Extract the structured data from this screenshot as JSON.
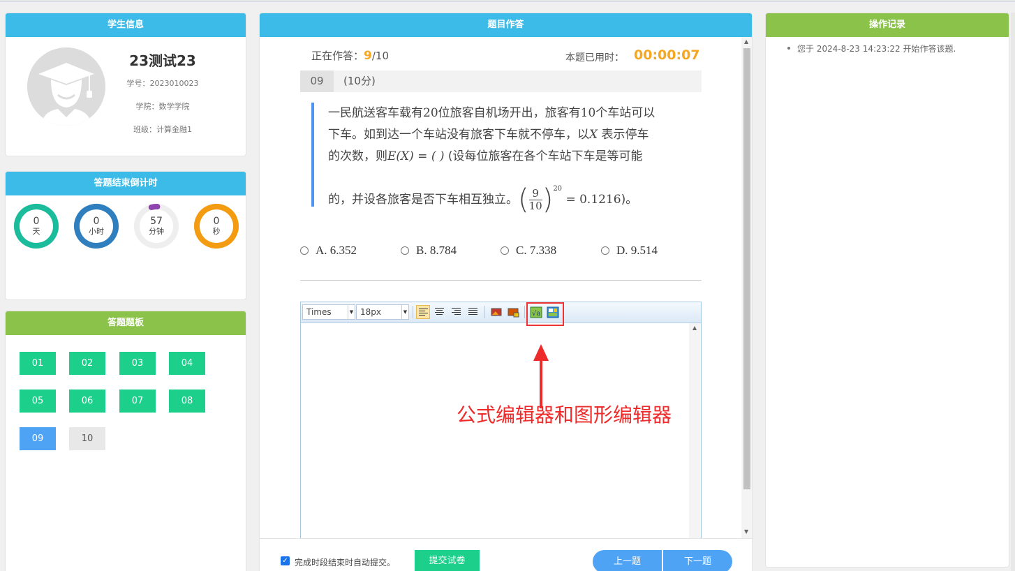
{
  "student": {
    "header": "学生信息",
    "name": "23测试23",
    "id_line": "学号：2023010023",
    "college_line": "学院：数学学院",
    "class_line": "班级：计算金融1"
  },
  "countdown": {
    "header": "答题结束倒计时",
    "rings": [
      {
        "value": "0",
        "unit": "天",
        "color": "#1abc9c",
        "fraction": 1.0
      },
      {
        "value": "0",
        "unit": "小时",
        "color": "#2f7fbf",
        "fraction": 1.0
      },
      {
        "value": "57",
        "unit": "分钟",
        "color": "#8e44ad",
        "fraction": 0.05
      },
      {
        "value": "0",
        "unit": "秒",
        "color": "#f39c12",
        "fraction": 1.0
      }
    ]
  },
  "board": {
    "header": "答题题板",
    "questions": [
      {
        "label": "01",
        "state": "answered"
      },
      {
        "label": "02",
        "state": "answered"
      },
      {
        "label": "03",
        "state": "answered"
      },
      {
        "label": "04",
        "state": "answered"
      },
      {
        "label": "05",
        "state": "answered"
      },
      {
        "label": "06",
        "state": "answered"
      },
      {
        "label": "07",
        "state": "answered"
      },
      {
        "label": "08",
        "state": "answered"
      },
      {
        "label": "09",
        "state": "current"
      },
      {
        "label": "10",
        "state": "pending"
      }
    ]
  },
  "center": {
    "header": "题目作答",
    "progress_label": "正在作答：",
    "progress_current": "9",
    "progress_total": "/10",
    "timer_label": "本题已用时：",
    "timer_value": "00:00:07",
    "question_no": "09",
    "question_score": "(10分)",
    "stem": {
      "l1a": "一民航送客车载有",
      "l1n": "20",
      "l1b": "位旅客自机场开出，旅客有",
      "l1n2": "10",
      "l1c": "个车站可以",
      "l2a": "下车。如到达一个车站没有旅客下车就不停车，以",
      "l2x": "X",
      "l2b": "表示停车",
      "l3a": "的次数，则",
      "l3e": "E(X) = (     )",
      "l3b": "(设每位旅客在各个车站下车是等可能",
      "l4a": "的，并设各旅客是否下车相互独立。",
      "frac_num": "9",
      "frac_den": "10",
      "exp": "20",
      "l4b": "= 0.1216",
      "l4c": ")。"
    },
    "options": [
      {
        "label": "A. 6.352"
      },
      {
        "label": "B. 8.784"
      },
      {
        "label": "C. 7.338"
      },
      {
        "label": "D. 9.514"
      }
    ],
    "editor": {
      "font_value": "Times",
      "size_value": "18px"
    },
    "annotation": "公式编辑器和图形编辑器",
    "auto_submit_label": "完成时段结束时自动提交。",
    "auto_submit_checked": true,
    "submit_label": "提交试卷",
    "prev_label": "上一题",
    "next_label": "下一题"
  },
  "log": {
    "header": "操作记录",
    "entries": [
      "您于 2024-8-23  14:23:22 开始作答该题."
    ]
  }
}
